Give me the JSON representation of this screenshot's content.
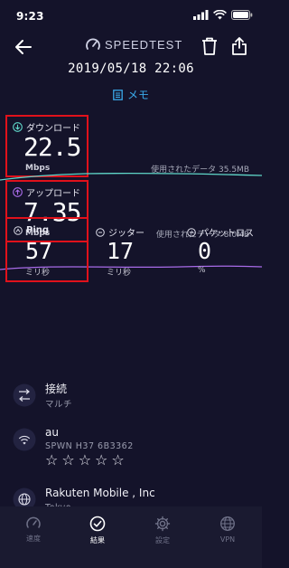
{
  "status_bar": {
    "time": "9:23"
  },
  "header": {
    "brand": "SPEEDTEST",
    "datetime": "2019/05/18 22:06",
    "memo_label": "メモ"
  },
  "download": {
    "title": "ダウンロード",
    "value": "22.5",
    "unit": "Mbps",
    "data_used": "使用されたデータ 35.5MB"
  },
  "upload": {
    "title": "アップロード",
    "value": "7.35",
    "unit": "Mbps",
    "data_used": "使用されたデータ 8.0MB"
  },
  "ping": {
    "title": "Ping",
    "value": "57",
    "unit": "ミリ秒"
  },
  "jitter": {
    "title": "ジッター",
    "value": "17",
    "unit": "ミリ秒"
  },
  "packet_loss": {
    "title": "パケットロス",
    "value": "0",
    "unit": "%"
  },
  "connection": {
    "title": "接続",
    "value": "マルチ"
  },
  "carrier": {
    "name": "au",
    "details": "SPWN  H37  6B3362",
    "rating": 0,
    "max_rating": 5
  },
  "server": {
    "name": "Rakuten Mobile , Inc",
    "location": "Tokyo"
  },
  "colors": {
    "download_line": "#5fd6c8",
    "upload_line": "#a86be8",
    "accent": "#3aa9e8",
    "highlight_box": "#e0111b"
  },
  "nav": {
    "items": [
      {
        "label": "速度",
        "icon": "gauge-icon"
      },
      {
        "label": "結果",
        "icon": "check-circle-icon",
        "active": true
      },
      {
        "label": "設定",
        "icon": "gear-icon"
      },
      {
        "label": "VPN",
        "icon": "globe-icon"
      }
    ]
  }
}
